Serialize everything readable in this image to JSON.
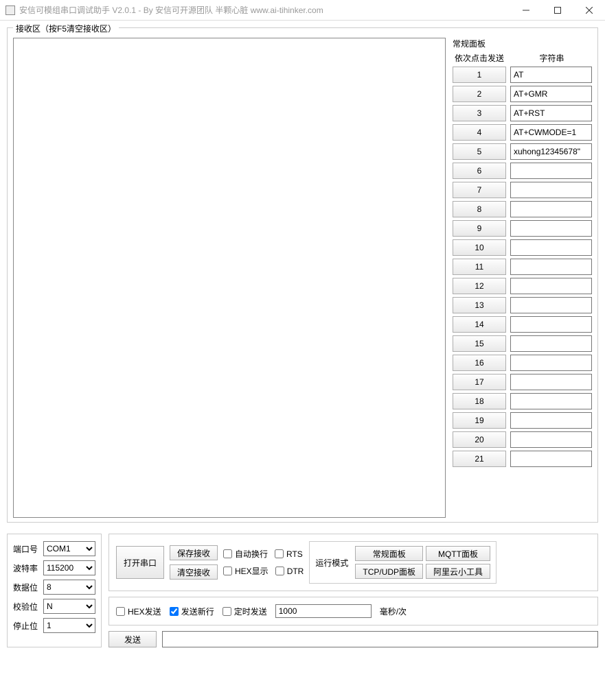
{
  "title": "安信可模组串口调试助手 V2.0.1 - By 安信可开源团队 半颗心脏 www.ai-tihinker.com",
  "receive_group_label": "接收区（按F5清空接收区）",
  "cmd_panel": {
    "title": "常规面板",
    "col_btn": "依次点击发送",
    "col_str": "字符串",
    "rows": [
      {
        "n": "1",
        "v": "AT"
      },
      {
        "n": "2",
        "v": "AT+GMR"
      },
      {
        "n": "3",
        "v": "AT+RST"
      },
      {
        "n": "4",
        "v": "AT+CWMODE=1"
      },
      {
        "n": "5",
        "v": "xuhong12345678\""
      },
      {
        "n": "6",
        "v": ""
      },
      {
        "n": "7",
        "v": ""
      },
      {
        "n": "8",
        "v": ""
      },
      {
        "n": "9",
        "v": ""
      },
      {
        "n": "10",
        "v": ""
      },
      {
        "n": "11",
        "v": ""
      },
      {
        "n": "12",
        "v": ""
      },
      {
        "n": "13",
        "v": ""
      },
      {
        "n": "14",
        "v": ""
      },
      {
        "n": "15",
        "v": ""
      },
      {
        "n": "16",
        "v": ""
      },
      {
        "n": "17",
        "v": ""
      },
      {
        "n": "18",
        "v": ""
      },
      {
        "n": "19",
        "v": ""
      },
      {
        "n": "20",
        "v": ""
      },
      {
        "n": "21",
        "v": ""
      }
    ]
  },
  "port": {
    "port_label": "端口号",
    "port_value": "COM1",
    "baud_label": "波特率",
    "baud_value": "115200",
    "data_label": "数据位",
    "data_value": "8",
    "parity_label": "校验位",
    "parity_value": "N",
    "stop_label": "停止位",
    "stop_value": "1"
  },
  "controls": {
    "open": "打开串口",
    "save": "保存接收",
    "clear": "清空接收",
    "auto_wrap": "自动换行",
    "hex_show": "HEX显示",
    "rts": "RTS",
    "dtr": "DTR",
    "mode_label": "运行模式",
    "mode_normal": "常规面板",
    "mode_mqtt": "MQTT面板",
    "mode_tcp": "TCP/UDP面板",
    "mode_aliyun": "阿里云小工具"
  },
  "send_opts": {
    "hex_send": "HEX发送",
    "send_newline": "发送新行",
    "timed_send": "定时发送",
    "interval": "1000",
    "unit": "毫秒/次"
  },
  "send": {
    "btn": "发送",
    "value": ""
  }
}
